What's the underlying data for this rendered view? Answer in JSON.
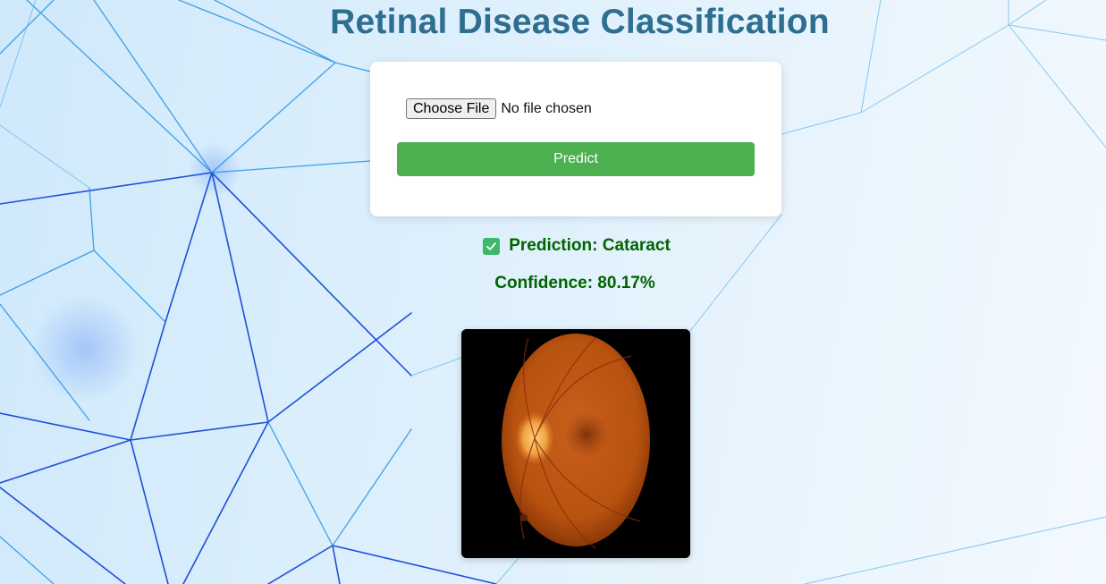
{
  "header": {
    "title": "Retinal Disease Classification"
  },
  "upload_form": {
    "choose_file_label": "Choose File",
    "file_status": "No file chosen",
    "predict_label": "Predict"
  },
  "result": {
    "check_icon": "check-mark-button-icon",
    "prediction_text": "Prediction: Cataract",
    "confidence_text": "Confidence: 80.17%"
  },
  "colors": {
    "title": "#2e6e90",
    "predict_button": "#4caf50",
    "result_text": "#006400",
    "background": "#dff0fc"
  }
}
